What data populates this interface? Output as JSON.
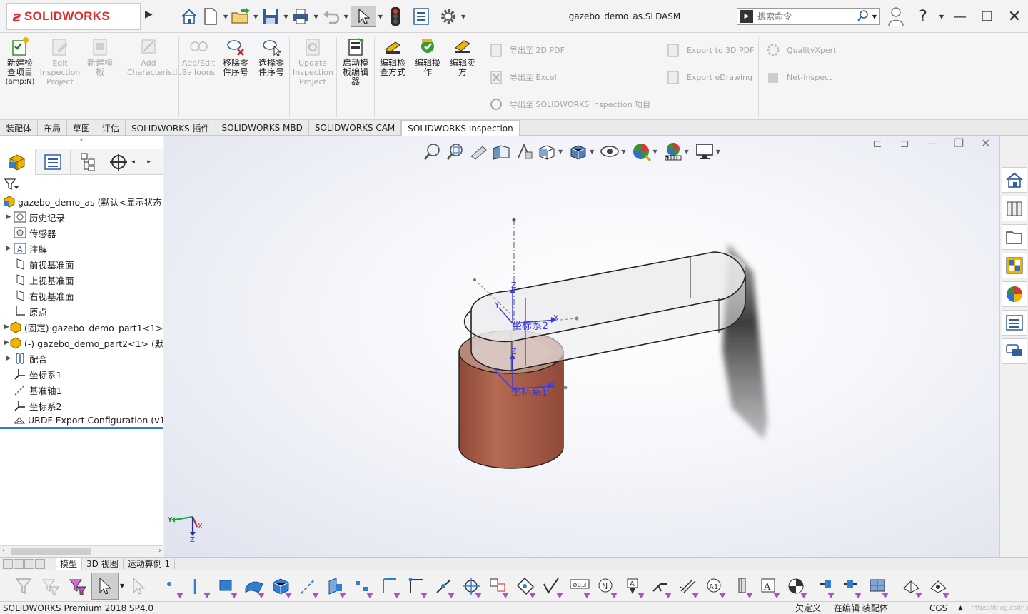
{
  "app": {
    "brand_ds": "3DS",
    "brand_name": "SOLIDWORKS",
    "document_title": "gazebo_demo_as.SLDASM"
  },
  "search": {
    "placeholder": "搜索命令"
  },
  "ribbon": {
    "new_inspection": "新建检查项目",
    "new_inspection_sub": "(amp;N)",
    "edit_inspection": "Edit Inspection Project",
    "new_template": "新建模板",
    "add_characteristic": "Add Characteristic",
    "add_edit_balloons": "Add/Edit Balloons",
    "remove_part_numbers": "移除零件序号",
    "select_part_numbers": "选择零件序号",
    "update_inspection": "Update Inspection Project",
    "launch_template_editor": "启动模板编辑器",
    "edit_inspection_method": "编辑检查方式",
    "edit_operation": "编辑操作",
    "edit_vendor": "编辑卖方",
    "export_2d_pdf": "导出至 2D PDF",
    "export_excel": "导出至 Excel",
    "export_sw_inspection": "导出至 SOLIDWORKS Inspection 项目",
    "export_3d_pdf": "Export to 3D PDF",
    "export_edrawing": "Export eDrawing",
    "qualityxpert": "QualityXpert",
    "net_inspect": "Net-Inspect"
  },
  "tabs": [
    "装配体",
    "布局",
    "草图",
    "评估",
    "SOLIDWORKS 插件",
    "SOLIDWORKS MBD",
    "SOLIDWORKS CAM",
    "SOLIDWORKS Inspection"
  ],
  "tree": {
    "root": "gazebo_demo_as  (默认<显示状态-",
    "items": [
      "历史记录",
      "传感器",
      "注解",
      "前视基准面",
      "上视基准面",
      "右视基准面",
      "原点",
      "(固定) gazebo_demo_part1<1>",
      "(-) gazebo_demo_part2<1> (默",
      "配合",
      "坐标系1",
      "基准轴1",
      "坐标系2",
      "URDF Export Configuration (v1"
    ]
  },
  "viewport": {
    "csys2_label": "坐标系2",
    "csys1_label": "坐标系1",
    "axis_x": "X",
    "axis_y": "Y",
    "axis_z": "Z",
    "colors": {
      "cylinder": "#a85e48",
      "slot": "#e7e7ea",
      "shadow": "#3d3d3d",
      "triad_x": "#cc2222",
      "triad_y": "#23a23a",
      "triad_z": "#2233aa",
      "csys": "#3a3ae0"
    }
  },
  "bottom_tabs": [
    "模型",
    "3D 视图",
    "运动算例 1"
  ],
  "status": {
    "product": "SOLIDWORKS Premium 2018 SP4.0",
    "under_defined": "欠定义",
    "editing": "在编辑 装配体",
    "units": "CGS",
    "watermark": "https://blog.csdn.net/qq_..."
  }
}
